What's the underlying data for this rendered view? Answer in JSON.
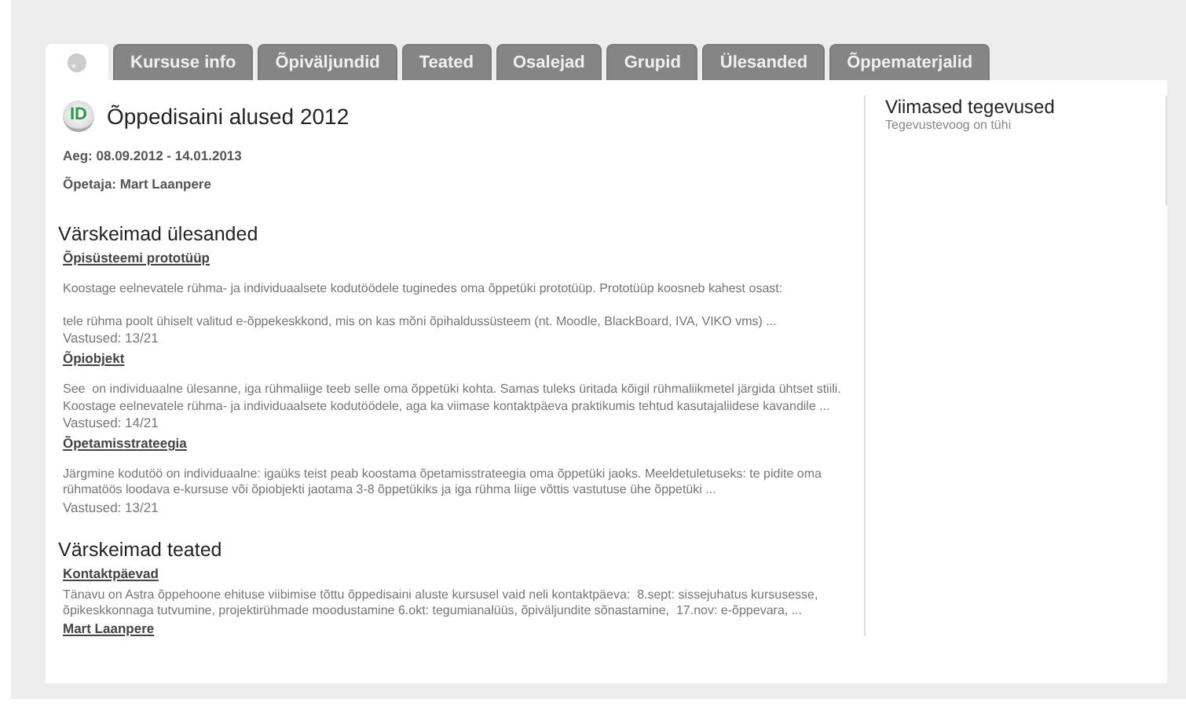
{
  "tabs": [
    {
      "kind": "icon",
      "selected": true
    },
    {
      "kind": "text",
      "label": "Kursuse info",
      "selected": false
    },
    {
      "kind": "text",
      "label": "Õpiväljundid",
      "selected": false
    },
    {
      "kind": "text",
      "label": "Teated",
      "selected": false
    },
    {
      "kind": "text",
      "label": "Osalejad",
      "selected": false
    },
    {
      "kind": "text",
      "label": "Grupid",
      "selected": false
    },
    {
      "kind": "text",
      "label": "Ülesanded",
      "selected": false
    },
    {
      "kind": "text",
      "label": "Õppematerjalid",
      "selected": false
    }
  ],
  "course": {
    "logo": "ID",
    "title": "Õppedisaini alused 2012",
    "period": "Aeg: 08.09.2012 - 14.01.2013",
    "teacher": "Õpetaja: Mart Laanpere"
  },
  "tasks": {
    "heading": "Värskeimad ülesanded",
    "items": [
      {
        "title": "Õpisüsteemi prototüüp",
        "description": "Koostage eelnevatele rühma- ja individuaalsete kodutöödele tuginedes oma õppetüki prototüüp. Prototüüp koosneb kahest osast:\n\ntele rühma poolt ühiselt valitud e-õppekeskkond, mis on kas mõni õpihaldussüsteem (nt. Moodle, BlackBoard, IVA, VIKO vms) ...",
        "answers": "Vastused: 13/21"
      },
      {
        "title": "Õpiobjekt",
        "description": "See  on individuaalne ülesanne, iga rühmaliige teeb selle oma õppetüki kohta. Samas tuleks üritada kõigil rühmaliikmetel järgida ühtset stiili. Koostage eelnevatele rühma- ja individuaalsete kodutöödele, aga ka viimase kontaktpäeva praktikumis tehtud kasutajaliidese kavandile ...",
        "answers": "Vastused: 14/21"
      },
      {
        "title": "Õpetamisstrateegia",
        "description": "Järgmine kodutöö on individuaalne: igaüks teist peab koostama õpetamisstrateegia oma õppetüki jaoks. Meeldetuletuseks: te pidite oma rühmatöös loodava e-kursuse või õpiobjekti jaotama 3-8 õppetükiks ja iga rühma liige võttis vastutuse ühe õppetüki ...",
        "answers": "Vastused: 13/21"
      }
    ]
  },
  "news": {
    "heading": "Värskeimad teated",
    "items": [
      {
        "title": "Kontaktpäevad",
        "body": "Tänavu on Astra õppehoone ehituse viibimise tõttu õppedisaini aluste kursusel vaid neli kontaktpäeva:  8.sept: sissejuhatus kursusesse, õpikeskkonnaga tutvumine, projektirühmade moodustamine 6.okt: tegumianalüüs, õpiväljundite sõnastamine,  17.nov: e-õppevara, ...",
        "author": "Mart Laanpere"
      }
    ]
  },
  "activity": {
    "heading": "Viimased tegevused",
    "empty": "Tegevustevoog on tühi"
  }
}
